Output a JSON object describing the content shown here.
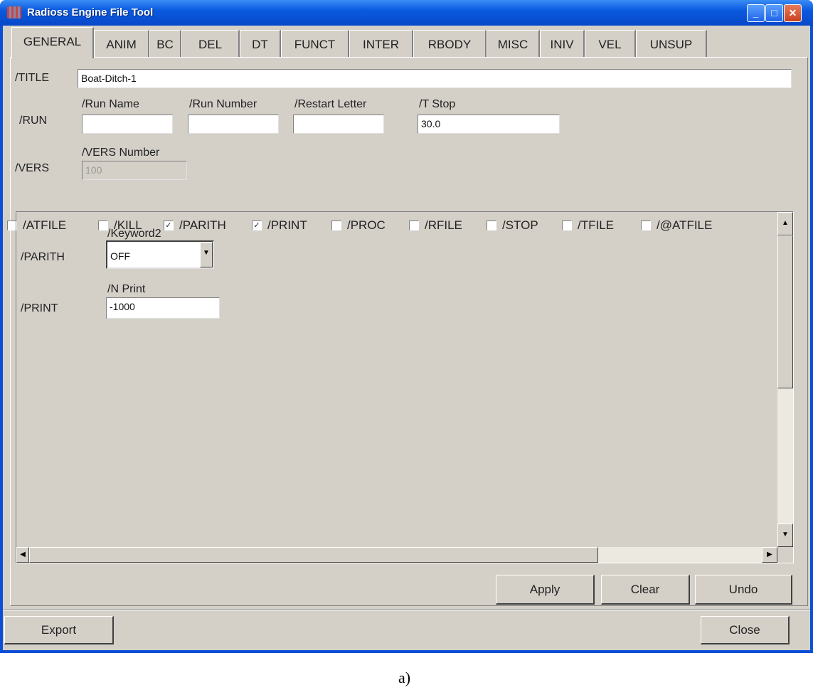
{
  "window": {
    "title": "Radioss Engine File Tool",
    "minimize": "_",
    "maximize": "□",
    "close": "✕"
  },
  "tabs": [
    "GENERAL",
    "ANIM",
    "BC",
    "DEL",
    "DT",
    "FUNCT",
    "INTER",
    "RBODY",
    "MISC",
    "INIV",
    "VEL",
    "UNSUP"
  ],
  "title_row": {
    "label": "/TITLE",
    "value": "Boat-Ditch-1"
  },
  "run_row": {
    "label": "/RUN",
    "fields": [
      {
        "label": "/Run Name",
        "value": ""
      },
      {
        "label": "/Run Number",
        "value": ""
      },
      {
        "label": "/Restart Letter",
        "value": ""
      },
      {
        "label": "/T Stop",
        "value": "30.0"
      }
    ]
  },
  "vers_row": {
    "label": "/VERS",
    "field_label": "/VERS Number",
    "value": "100"
  },
  "checkboxes": [
    {
      "label": "/ATFILE",
      "checked": false,
      "mark": ""
    },
    {
      "label": "/KILL",
      "checked": false,
      "mark": ""
    },
    {
      "label": "/PARITH",
      "checked": true,
      "mark": "✓"
    },
    {
      "label": "/PRINT",
      "checked": true,
      "mark": "✓"
    },
    {
      "label": "/PROC",
      "checked": false,
      "mark": ""
    },
    {
      "label": "/RFILE",
      "checked": false,
      "mark": ""
    },
    {
      "label": "/STOP",
      "checked": false,
      "mark": ""
    },
    {
      "label": "/TFILE",
      "checked": false,
      "mark": ""
    },
    {
      "label": "/@ATFILE",
      "checked": false,
      "mark": ""
    }
  ],
  "parith": {
    "label": "/PARITH",
    "field_label": "/Keyword2",
    "value": "OFF"
  },
  "print": {
    "label": "/PRINT",
    "field_label": "/N Print",
    "value": "-1000"
  },
  "buttons": {
    "apply": "Apply",
    "clear": "Clear",
    "undo": "Undo",
    "export": "Export",
    "close": "Close"
  },
  "caption": "a)"
}
